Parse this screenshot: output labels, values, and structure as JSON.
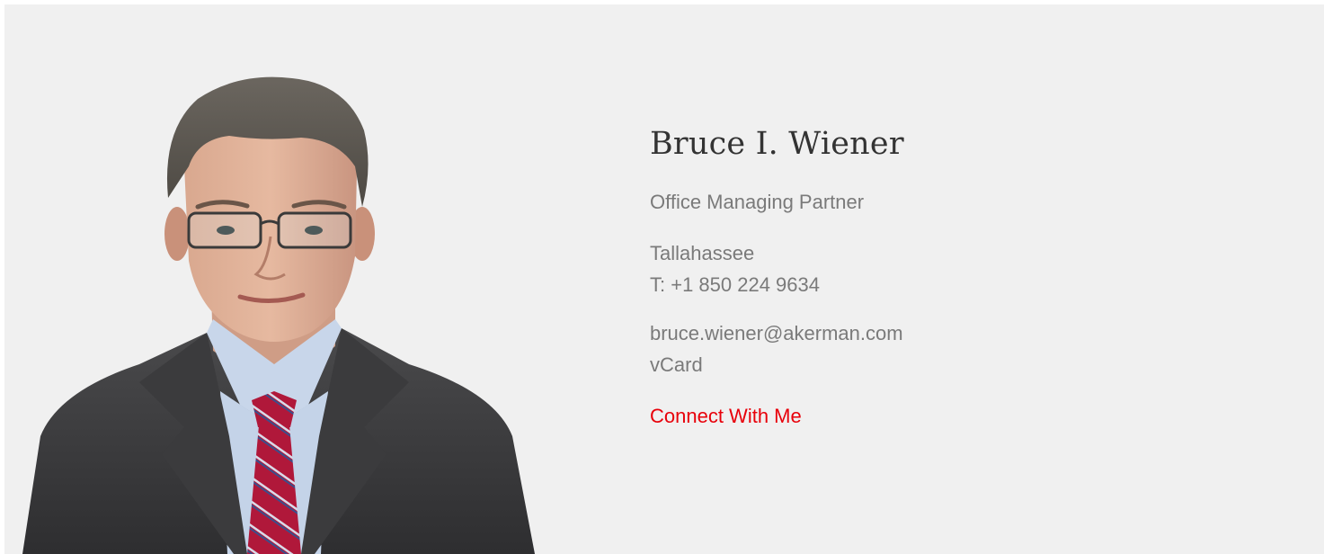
{
  "profile": {
    "name": "Bruce I. Wiener",
    "position": "Office Managing Partner",
    "office": "Tallahassee",
    "phone": "T: +1 850 224 9634",
    "email": "bruce.wiener@akerman.com",
    "vcard": "vCard",
    "connect": "Connect With Me"
  },
  "colors": {
    "background": "#f0f0f0",
    "name": "#333333",
    "text": "#7a7a7a",
    "accent": "#e8000a"
  },
  "portrait": {
    "icon": "person-portrait-photo"
  }
}
